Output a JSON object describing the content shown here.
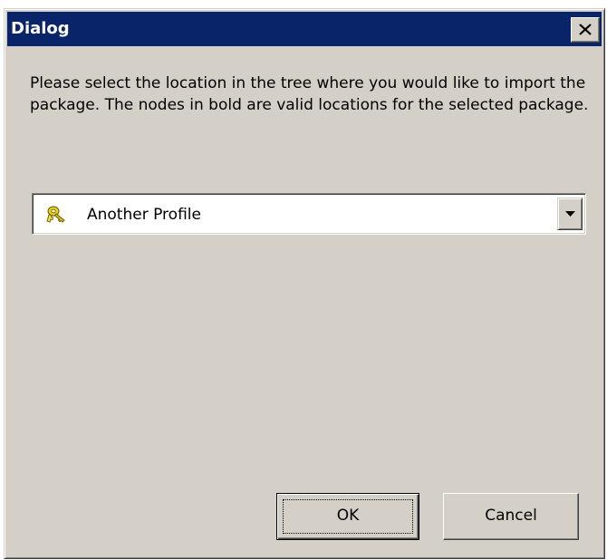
{
  "dialog": {
    "title": "Dialog",
    "close_icon": "close-icon",
    "instructions": "Please select the location in the tree where you would like to import the package. The nodes in bold are valid locations for the selected package.",
    "location_select": {
      "selected_value": "Another Profile",
      "icon": "profile-keys-icon",
      "arrow_icon": "chevron-down-icon"
    },
    "buttons": {
      "ok_label": "OK",
      "cancel_label": "Cancel"
    }
  },
  "colors": {
    "title_bar": "#0a246a",
    "window_face": "#d4d0c8",
    "field_background": "#ffffff"
  }
}
